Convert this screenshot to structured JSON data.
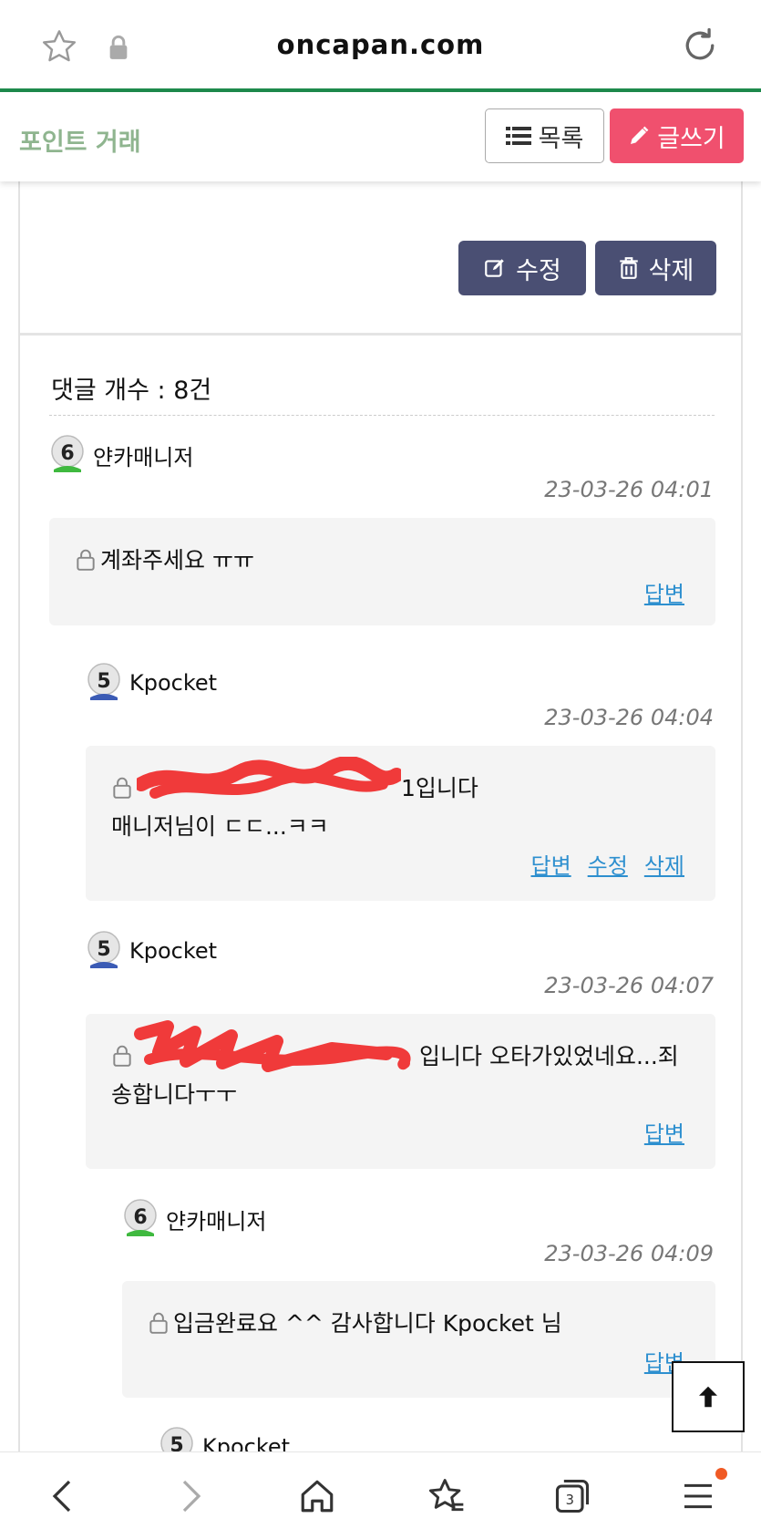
{
  "browser": {
    "url": "oncapan.com"
  },
  "header": {
    "board_title": "포인트 거래",
    "list_label": "목록",
    "write_label": "글쓰기"
  },
  "post": {
    "edit_label": "수정",
    "delete_label": "삭제"
  },
  "comments_section": {
    "count_text": "댓글 개수 : 8건"
  },
  "comments": [
    {
      "level": "6",
      "author": "얀카매니저",
      "date": "23-03-26 04:01",
      "lines": [
        "계좌주세요 ㅠㅠ"
      ],
      "links": [
        "답변"
      ]
    },
    {
      "level": "5",
      "author": "Kpocket",
      "date": "23-03-26 04:04",
      "lines": [
        "1입니다",
        "매니저님이 ㄷㄷ...ㅋㅋ"
      ],
      "links": [
        "답변",
        "수정",
        "삭제"
      ]
    },
    {
      "level": "5",
      "author": "Kpocket",
      "date": "23-03-26 04:07",
      "lines": [
        "입니다 오타가있었네요...죄",
        "송합니다ㅜㅜ"
      ],
      "links": [
        "답변"
      ]
    },
    {
      "level": "6",
      "author": "얀카매니저",
      "date": "23-03-26 04:09",
      "lines": [
        "입금완료요 ^^ 감사합니다  Kpocket 님"
      ],
      "links": [
        "답변"
      ]
    },
    {
      "level": "5",
      "author": "Kpocket"
    }
  ],
  "icons": {
    "bookmark": "star-icon",
    "secure": "lock-icon",
    "reload": "reload-icon",
    "list": "list-icon",
    "write": "pencil-icon",
    "edit": "edit-icon",
    "delete": "trash-icon",
    "secret": "lock-icon",
    "scroll_top": "arrow-up-icon",
    "nav": [
      "back-icon",
      "forward-icon",
      "home-icon",
      "bookmarks-icon",
      "tabs-icon",
      "menu-icon"
    ]
  },
  "tab_count": "3",
  "colors": {
    "accent_green": "#1e8a4c",
    "board_title": "#8fb58f",
    "write_button": "#f0506e",
    "dark_button": "#4a4f73",
    "link": "#2d8fcf"
  }
}
